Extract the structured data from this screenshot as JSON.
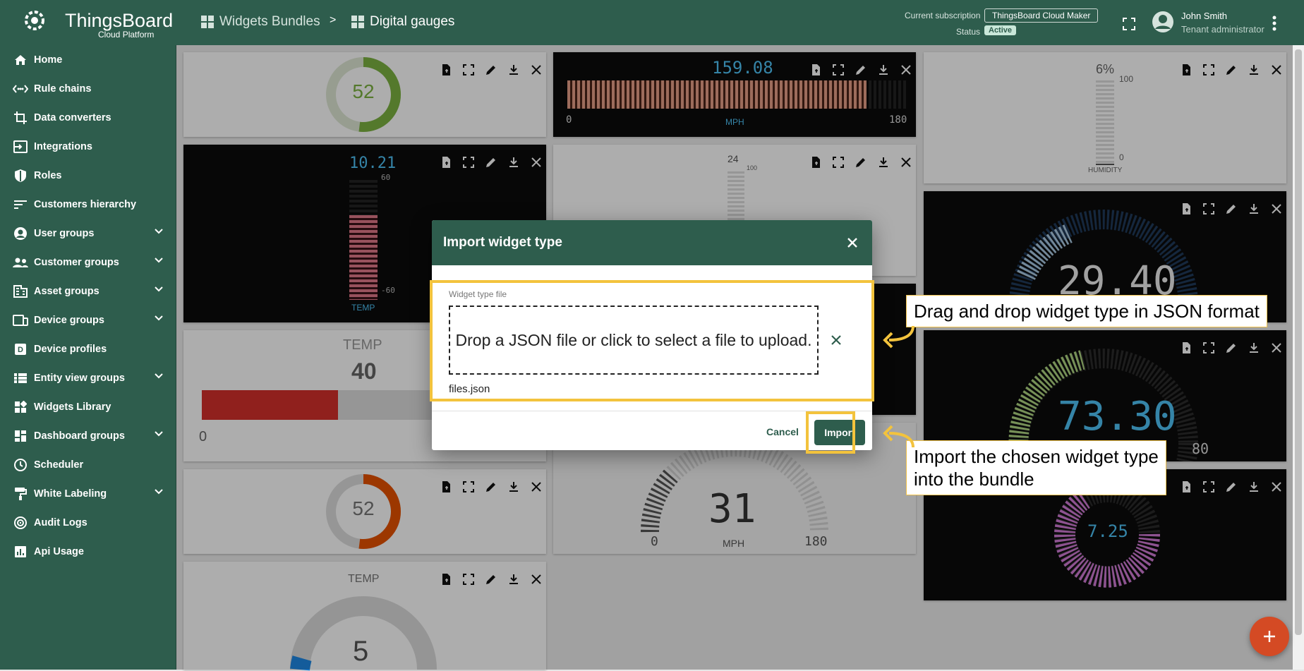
{
  "header": {
    "logo_main": "ThingsBoard",
    "logo_sub": "Cloud Platform",
    "breadcrumb": [
      {
        "label": "Widgets Bundles"
      },
      {
        "label": "Digital gauges"
      }
    ],
    "breadcrumb_sep": ">",
    "subscription_label": "Current subscription",
    "subscription_value": "ThingsBoard Cloud Maker",
    "status_label": "Status",
    "status_value": "Active",
    "user_name": "John Smith",
    "user_role": "Tenant administrator"
  },
  "sidebar": {
    "items": [
      {
        "label": "Home",
        "icon": "home-icon",
        "expandable": false
      },
      {
        "label": "Rule chains",
        "icon": "rule-chain-icon",
        "expandable": false
      },
      {
        "label": "Data converters",
        "icon": "converter-icon",
        "expandable": false
      },
      {
        "label": "Integrations",
        "icon": "integration-icon",
        "expandable": false
      },
      {
        "label": "Roles",
        "icon": "shield-icon",
        "expandable": false
      },
      {
        "label": "Customers hierarchy",
        "icon": "hierarchy-icon",
        "expandable": false
      },
      {
        "label": "User groups",
        "icon": "user-icon",
        "expandable": true
      },
      {
        "label": "Customer groups",
        "icon": "group-icon",
        "expandable": true
      },
      {
        "label": "Asset groups",
        "icon": "asset-icon",
        "expandable": true
      },
      {
        "label": "Device groups",
        "icon": "device-icon",
        "expandable": true
      },
      {
        "label": "Device profiles",
        "icon": "device-profile-icon",
        "expandable": false
      },
      {
        "label": "Entity view groups",
        "icon": "entity-view-icon",
        "expandable": true
      },
      {
        "label": "Widgets Library",
        "icon": "widgets-icon",
        "expandable": false
      },
      {
        "label": "Dashboard groups",
        "icon": "dashboard-icon",
        "expandable": true
      },
      {
        "label": "Scheduler",
        "icon": "clock-icon",
        "expandable": false
      },
      {
        "label": "White Labeling",
        "icon": "paint-icon",
        "expandable": true
      },
      {
        "label": "Audit Logs",
        "icon": "audit-icon",
        "expandable": false
      },
      {
        "label": "Api Usage",
        "icon": "chart-icon",
        "expandable": false
      }
    ]
  },
  "widgets": {
    "w1_value": "52",
    "w2_value": "159.08",
    "w2_min": "0",
    "w2_max": "180",
    "w2_unit": "MPH",
    "w3_value": "6%",
    "w3_max": "100",
    "w3_min": "0",
    "w3_label": "HUMIDITY",
    "w4_value": "10.21",
    "w4_max": "60",
    "w4_min": "-60",
    "w4_label": "TEMP",
    "w5_value": "24",
    "w5_max": "100",
    "w6_value": "29.40",
    "w7_title": "TEMP",
    "w7_value": "40",
    "w7_min": "0",
    "w7_fill": 0.4,
    "w8_value": "73.30",
    "w8_max": "80",
    "w9_value": "52",
    "w10_value": "31",
    "w10_min": "0",
    "w10_max": "180",
    "w10_unit": "MPH",
    "w11_value": "7.25",
    "w12_title": "TEMP",
    "w12_value": "5"
  },
  "dialog": {
    "title": "Import widget type",
    "field_label": "Widget type file",
    "drop_text": "Drop a JSON file or click to select a file to upload.",
    "file_name": "files.json",
    "cancel_label": "Cancel",
    "import_label": "Import"
  },
  "callouts": {
    "drag_drop": "Drag and drop widget type in JSON format",
    "import_line1": "Import the chosen widget type",
    "import_line2": "into the bundle"
  },
  "colors": {
    "primary": "#2e5d4d",
    "accent": "#d44a24",
    "highlight": "#f3c33d"
  }
}
